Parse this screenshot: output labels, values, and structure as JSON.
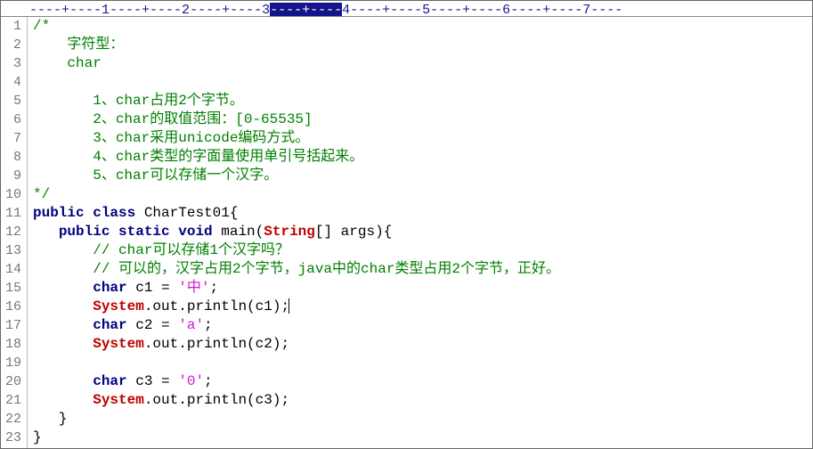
{
  "ruler": {
    "segments": [
      "----+----",
      "1",
      "----+----",
      "2",
      "----+----",
      "3",
      "----+----",
      "4",
      "----+----",
      "5",
      "----+----",
      "6",
      "----+----",
      "7",
      "----"
    ],
    "highlight_index": 6
  },
  "lines": [
    {
      "n": "1",
      "tokens": [
        [
          "cm",
          "/*"
        ]
      ]
    },
    {
      "n": "2",
      "tokens": [
        [
          "cm",
          "    字符型："
        ]
      ]
    },
    {
      "n": "3",
      "tokens": [
        [
          "cm",
          "    char"
        ]
      ]
    },
    {
      "n": "4",
      "tokens": [
        [
          "cm",
          ""
        ]
      ]
    },
    {
      "n": "5",
      "tokens": [
        [
          "cm",
          "       1、char占用2个字节。"
        ]
      ]
    },
    {
      "n": "6",
      "tokens": [
        [
          "cm",
          "       2、char的取值范围：[0-65535]"
        ]
      ]
    },
    {
      "n": "7",
      "tokens": [
        [
          "cm",
          "       3、char采用unicode编码方式。"
        ]
      ]
    },
    {
      "n": "8",
      "tokens": [
        [
          "cm",
          "       4、char类型的字面量使用单引号括起来。"
        ]
      ]
    },
    {
      "n": "9",
      "tokens": [
        [
          "cm",
          "       5、char可以存储一个汉字。"
        ]
      ]
    },
    {
      "n": "10",
      "tokens": [
        [
          "cm",
          "*/"
        ]
      ]
    },
    {
      "n": "11",
      "tokens": [
        [
          "kw",
          "public class "
        ],
        [
          "cls",
          "CharTest01"
        ],
        [
          "op",
          "{"
        ]
      ]
    },
    {
      "n": "12",
      "tokens": [
        [
          "op",
          "   "
        ],
        [
          "kw",
          "public static void "
        ],
        [
          "cls",
          "main"
        ],
        [
          "op",
          "("
        ],
        [
          "typ",
          "String"
        ],
        [
          "op",
          "[] args){"
        ]
      ]
    },
    {
      "n": "13",
      "tokens": [
        [
          "cm",
          "       // char可以存储1个汉字吗？"
        ]
      ]
    },
    {
      "n": "14",
      "tokens": [
        [
          "cm",
          "       // 可以的，汉字占用2个字节，java中的char类型占用2个字节，正好。"
        ]
      ]
    },
    {
      "n": "15",
      "tokens": [
        [
          "op",
          "       "
        ],
        [
          "kw",
          "char"
        ],
        [
          "op",
          " c1 = "
        ],
        [
          "str",
          "'中'"
        ],
        [
          "op",
          ";"
        ]
      ]
    },
    {
      "n": "16",
      "tokens": [
        [
          "op",
          "       "
        ],
        [
          "typ",
          "System"
        ],
        [
          "op",
          ".out.println(c1);"
        ],
        [
          "caret",
          ""
        ]
      ]
    },
    {
      "n": "17",
      "tokens": [
        [
          "op",
          "       "
        ],
        [
          "kw",
          "char"
        ],
        [
          "op",
          " c2 = "
        ],
        [
          "str",
          "'a'"
        ],
        [
          "op",
          ";"
        ]
      ]
    },
    {
      "n": "18",
      "tokens": [
        [
          "op",
          "       "
        ],
        [
          "typ",
          "System"
        ],
        [
          "op",
          ".out.println(c2);"
        ]
      ]
    },
    {
      "n": "19",
      "tokens": [
        [
          "op",
          ""
        ]
      ]
    },
    {
      "n": "20",
      "tokens": [
        [
          "op",
          "       "
        ],
        [
          "kw",
          "char"
        ],
        [
          "op",
          " c3 = "
        ],
        [
          "str",
          "'0'"
        ],
        [
          "op",
          ";"
        ]
      ]
    },
    {
      "n": "21",
      "tokens": [
        [
          "op",
          "       "
        ],
        [
          "typ",
          "System"
        ],
        [
          "op",
          ".out.println(c3);"
        ]
      ]
    },
    {
      "n": "22",
      "tokens": [
        [
          "op",
          "   }"
        ]
      ]
    },
    {
      "n": "23",
      "tokens": [
        [
          "op",
          "}"
        ]
      ]
    }
  ]
}
